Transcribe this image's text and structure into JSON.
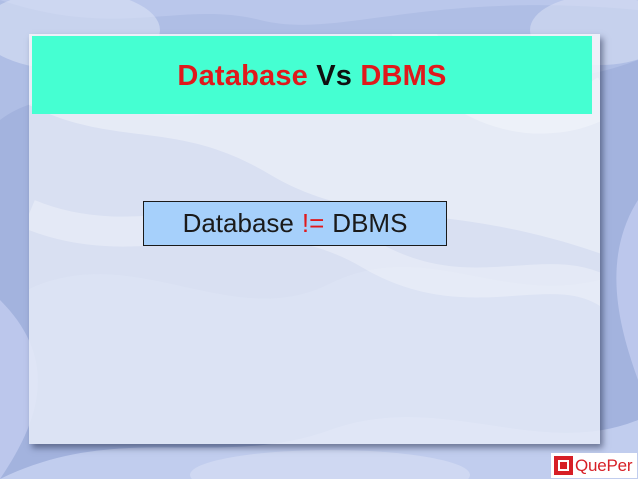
{
  "title": {
    "word1": "Database",
    "word2": "Vs",
    "word3": "DBMS"
  },
  "box": {
    "left_text": "Database",
    "operator": "!=",
    "right_text": "DBMS"
  },
  "logo": {
    "text": "QuePer"
  },
  "colors": {
    "title_bar": "#45ffd2",
    "title_red": "#e0191c",
    "box_fill": "#a6d0fb",
    "logo_red": "#d71f26"
  }
}
